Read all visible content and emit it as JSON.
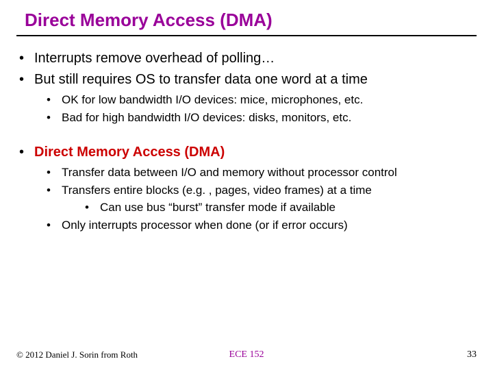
{
  "title": "Direct Memory Access (DMA)",
  "bullets": {
    "b1": "Interrupts remove overhead of polling…",
    "b2": "But still requires OS to transfer data one word at a time",
    "b2a": "OK for low bandwidth I/O devices: mice, microphones, etc.",
    "b2b": "Bad for high bandwidth I/O devices: disks, monitors, etc.",
    "b3": "Direct Memory Access (DMA)",
    "b3a": "Transfer data between I/O and memory without processor control",
    "b3b": "Transfers entire blocks (e.g. , pages, video frames) at a time",
    "b3b1": "Can use bus “burst” transfer mode if available",
    "b3c": "Only interrupts processor when done (or if error occurs)"
  },
  "footer": {
    "copyright": "© 2012 Daniel J. Sorin from Roth",
    "course": "ECE 152",
    "page": "33"
  }
}
